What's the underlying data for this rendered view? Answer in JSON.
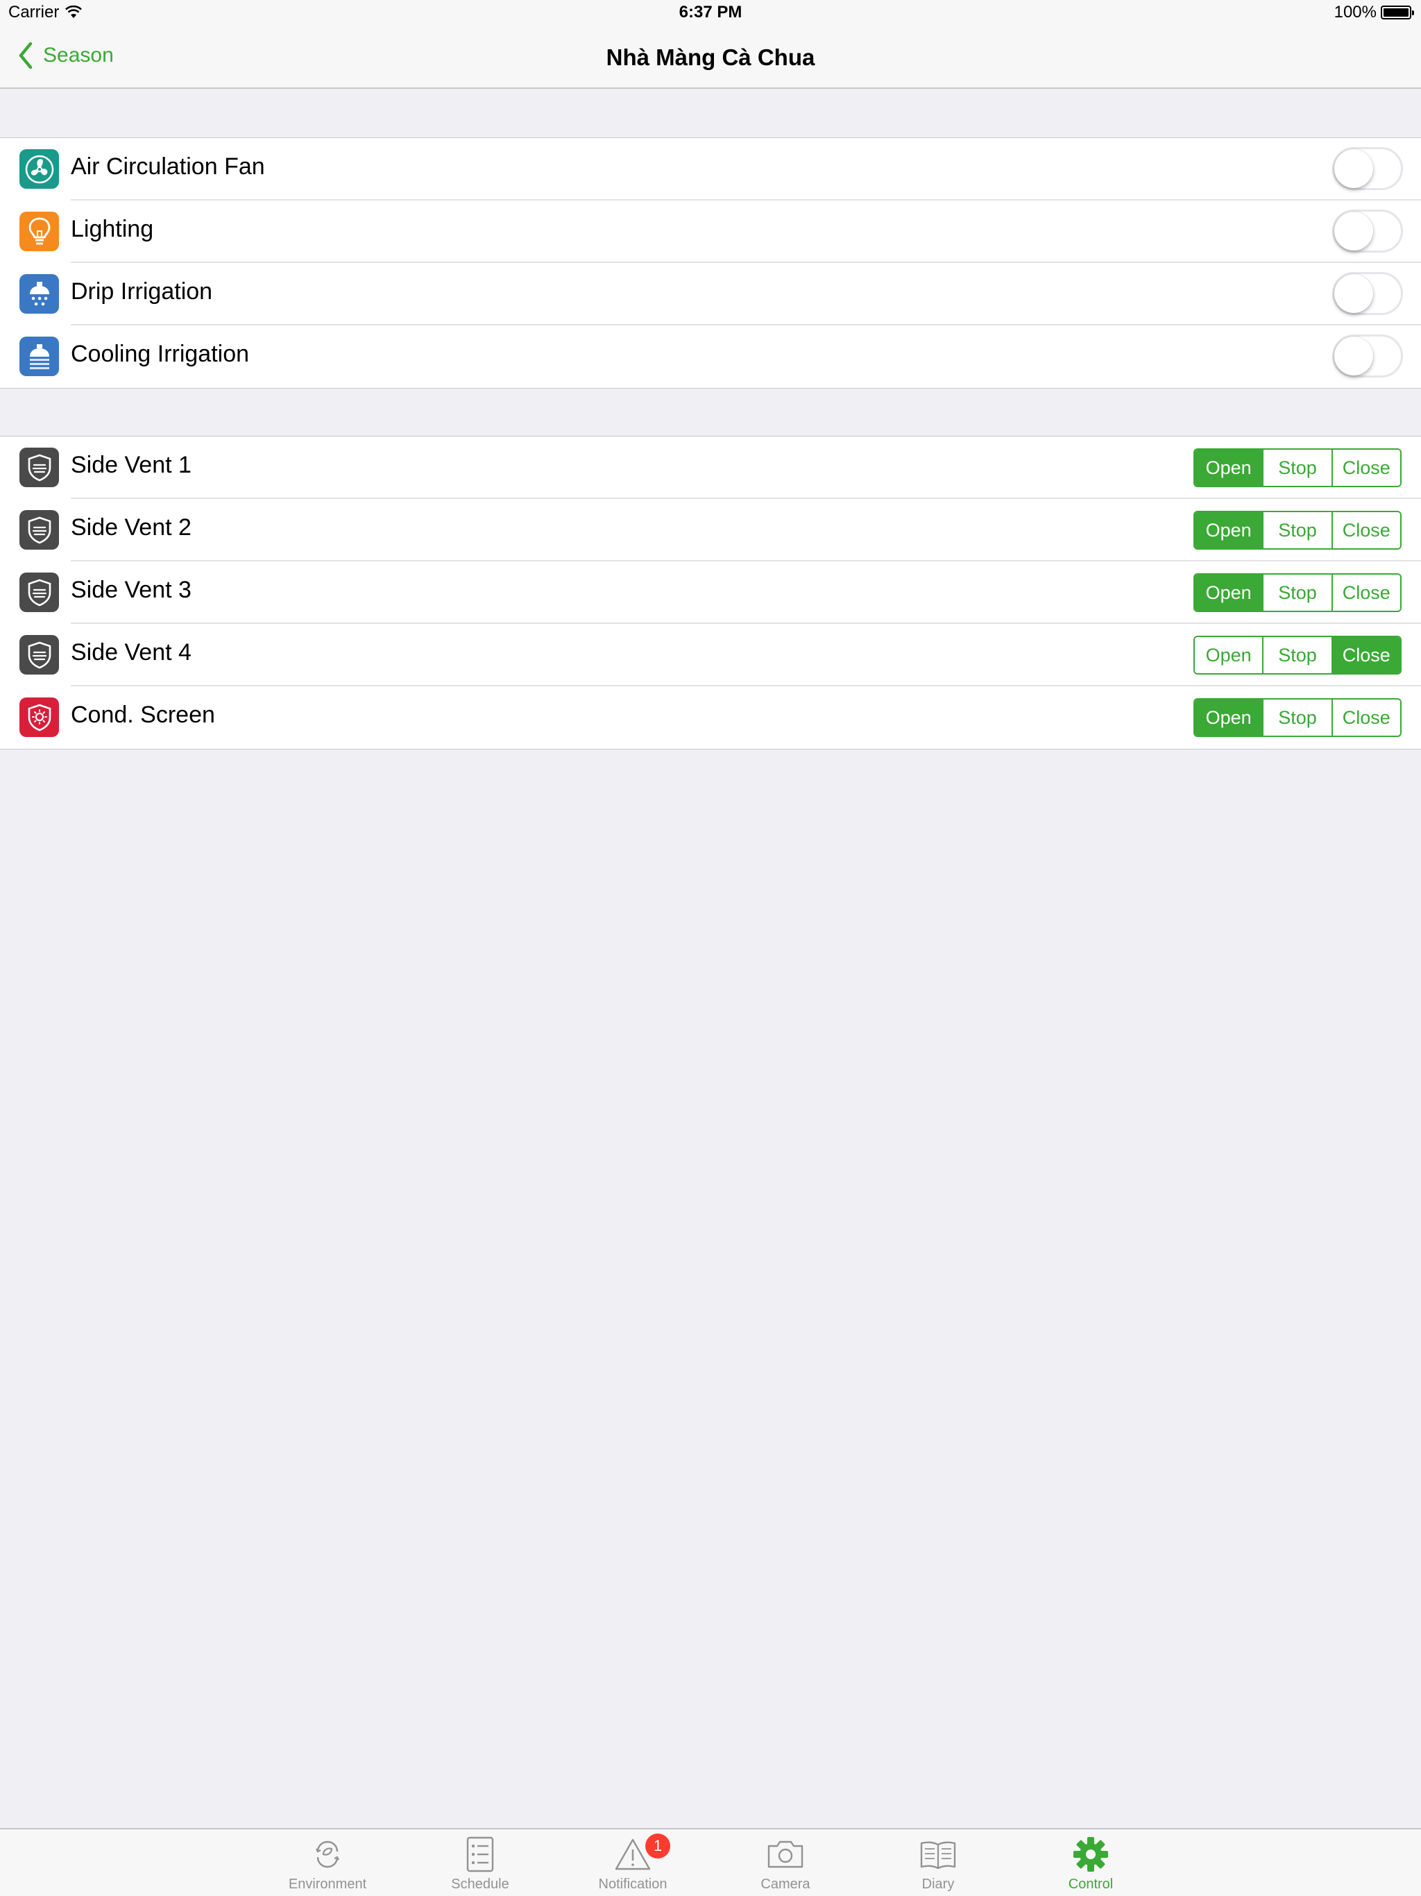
{
  "status_bar": {
    "carrier": "Carrier",
    "time": "6:37 PM",
    "battery": "100%"
  },
  "nav": {
    "back_label": "Season",
    "title": "Nhà Màng Cà Chua"
  },
  "colors": {
    "accent": "#3aa935",
    "fan": "#1a9a8a",
    "lighting": "#f58b1f",
    "irrigation": "#3a78c3",
    "vent": "#4a4a4a",
    "screen": "#d91e3a",
    "badge": "#ff3b30"
  },
  "switches": [
    {
      "label": "Air Circulation Fan",
      "icon": "fan-icon",
      "on": false
    },
    {
      "label": "Lighting",
      "icon": "bulb-icon",
      "on": false
    },
    {
      "label": "Drip Irrigation",
      "icon": "drip-irrigation-icon",
      "on": false
    },
    {
      "label": "Cooling Irrigation",
      "icon": "cooling-irrigation-icon",
      "on": false
    }
  ],
  "segment_labels": {
    "open": "Open",
    "stop": "Stop",
    "close": "Close"
  },
  "vents": [
    {
      "label": "Side Vent 1",
      "icon": "vent-icon",
      "selected": "open"
    },
    {
      "label": "Side Vent 2",
      "icon": "vent-icon",
      "selected": "open"
    },
    {
      "label": "Side Vent 3",
      "icon": "vent-icon",
      "selected": "open"
    },
    {
      "label": "Side Vent 4",
      "icon": "vent-icon",
      "selected": "close"
    },
    {
      "label": "Cond. Screen",
      "icon": "screen-icon",
      "selected": "open"
    }
  ],
  "tabs": [
    {
      "label": "Environment",
      "icon": "environment-icon",
      "active": false
    },
    {
      "label": "Schedule",
      "icon": "schedule-icon",
      "active": false
    },
    {
      "label": "Notification",
      "icon": "notification-icon",
      "active": false,
      "badge": "1"
    },
    {
      "label": "Camera",
      "icon": "camera-icon",
      "active": false
    },
    {
      "label": "Diary",
      "icon": "diary-icon",
      "active": false
    },
    {
      "label": "Control",
      "icon": "gear-icon",
      "active": true
    }
  ]
}
